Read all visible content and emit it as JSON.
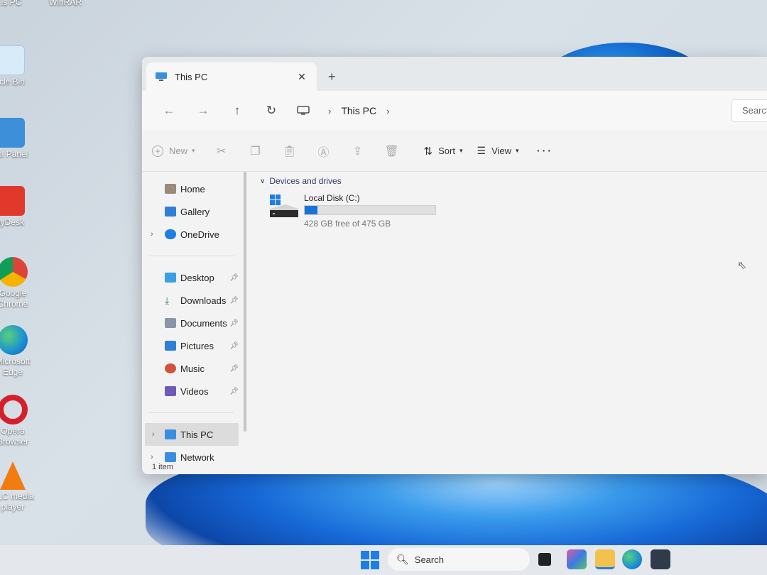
{
  "desktop": {
    "icons": [
      {
        "label": "is PC",
        "icon": "this-pc-icon",
        "color": "#4a8fd6"
      },
      {
        "label": "WinRAR",
        "icon": "winrar-icon",
        "color": "#7a2b6e"
      },
      {
        "label": "ycle Bin",
        "icon": "recycle-bin-icon",
        "color": "#cfe6f7"
      },
      {
        "label": "trol Panel",
        "icon": "control-panel-icon",
        "color": "#3c8fd8"
      },
      {
        "label": "nyDesk",
        "icon": "anydesk-icon",
        "color": "#e1382c"
      },
      {
        "label": "Google Chrome",
        "icon": "chrome-icon",
        "color": "#e8b12c"
      },
      {
        "label": "Microsoft Edge",
        "icon": "edge-icon",
        "color": "#1a8fd6"
      },
      {
        "label": "Opera Browser",
        "icon": "opera-icon",
        "color": "#d5202c"
      },
      {
        "label": "VLC media player",
        "icon": "vlc-icon",
        "color": "#f07c12"
      }
    ]
  },
  "window": {
    "tab": {
      "title": "This PC",
      "icon": "this-pc-icon",
      "close": "✕"
    },
    "new_tab": "+",
    "nav": {
      "back": "←",
      "forward": "→",
      "up": "↑",
      "refresh": "↻"
    },
    "address": {
      "segment": "This PC",
      "chevron": "›"
    },
    "search_placeholder": "Search",
    "toolbar": {
      "new_label": "New",
      "sort_label": "Sort",
      "view_label": "View",
      "more": "···"
    },
    "sidebar": {
      "top_items": [
        {
          "label": "Home",
          "icon": "home-icon"
        },
        {
          "label": "Gallery",
          "icon": "gallery-icon"
        },
        {
          "label": "OneDrive",
          "icon": "onedrive-icon"
        }
      ],
      "pinned_items": [
        {
          "label": "Desktop",
          "icon": "desktop-folder-icon"
        },
        {
          "label": "Downloads",
          "icon": "downloads-icon"
        },
        {
          "label": "Documents",
          "icon": "documents-icon"
        },
        {
          "label": "Pictures",
          "icon": "pictures-icon"
        },
        {
          "label": "Music",
          "icon": "music-icon"
        },
        {
          "label": "Videos",
          "icon": "videos-icon"
        }
      ],
      "bottom_items": [
        {
          "label": "This PC",
          "icon": "this-pc-icon"
        },
        {
          "label": "Network",
          "icon": "network-icon"
        }
      ]
    },
    "content": {
      "group_title": "Devices and drives",
      "drive": {
        "name": "Local Disk (C:)",
        "space": "428 GB free of 475 GB",
        "used_fraction": 0.099
      }
    },
    "status": "1 item"
  },
  "taskbar": {
    "search_label": "Search",
    "accent": "#1e7ee6"
  }
}
